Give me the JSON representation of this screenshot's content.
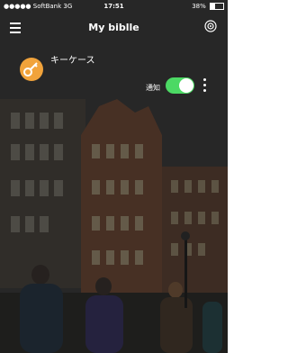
{
  "status_bar": {
    "carrier": "●●●●● SoftBank 3G",
    "time": "17:51",
    "battery": "38%"
  },
  "nav": {
    "title": "My biblle",
    "menu_icon": "hamburger-menu-icon",
    "action_icon": "target-icon"
  },
  "device": {
    "name": "キーケース",
    "icon": "key-icon",
    "notify_label": "通知",
    "notify_enabled": true
  },
  "colors": {
    "accent_orange": "#f1a33b",
    "toggle_on": "#4cd964"
  }
}
